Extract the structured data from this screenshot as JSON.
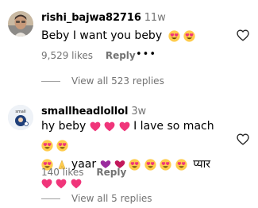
{
  "comments": [
    {
      "username": "rishi_bajwa82716",
      "age": "11w",
      "text": "Beby I want you beby",
      "likes": "9,529 likes",
      "reply_label": "Reply",
      "more": "•••",
      "view_replies": "View all 523 replies"
    },
    {
      "username": "smallheadlollol",
      "age": "3w",
      "line1_a": "hy beby",
      "line1_b": "I lave so mach",
      "line2_yaar": "yaar",
      "line2_pyaar": "प्यार",
      "likes": "140 likes",
      "reply_label": "Reply",
      "view_replies": "View all 5 replies"
    }
  ],
  "colors": {
    "secondary_text": "#737373",
    "heart_outline": "#262626",
    "emoji_face": "#ffcc4d",
    "emoji_heart": "#f0357a"
  }
}
